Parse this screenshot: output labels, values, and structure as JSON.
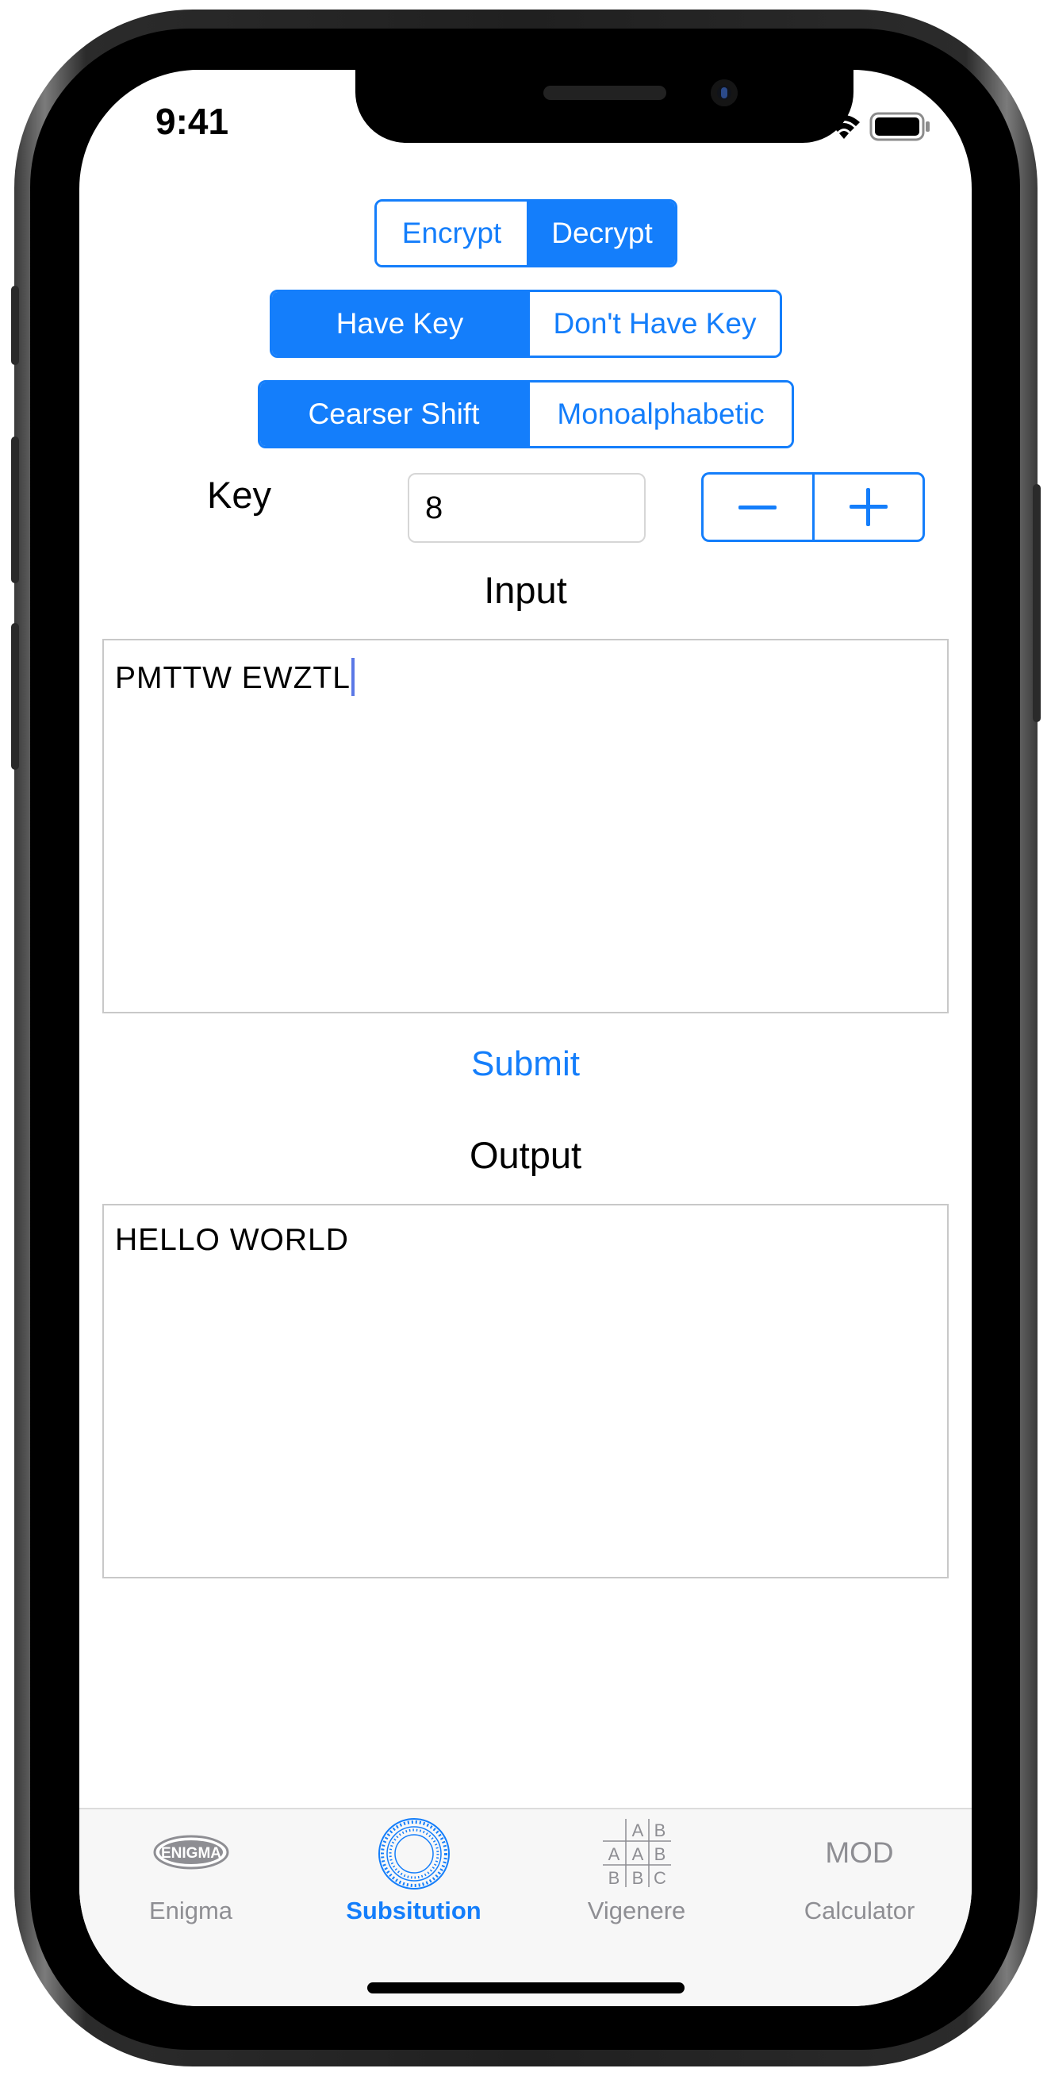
{
  "status_bar": {
    "time": "9:41"
  },
  "mode_segment": {
    "items": [
      "Encrypt",
      "Decrypt"
    ],
    "selected": "Decrypt"
  },
  "key_segment": {
    "items": [
      "Have Key",
      "Don't Have Key"
    ],
    "selected": "Have Key"
  },
  "cipher_segment": {
    "items": [
      "Cearser Shift",
      "Monoalphabetic"
    ],
    "selected": "Cearser Shift"
  },
  "key": {
    "label": "Key",
    "value": "8"
  },
  "input": {
    "label": "Input",
    "value": "PMTTW EWZTL"
  },
  "submit_label": "Submit",
  "output": {
    "label": "Output",
    "value": "HELLO WORLD"
  },
  "tabbar": {
    "tabs": [
      {
        "label": "Enigma",
        "icon": "enigma-logo-icon",
        "logo_text": "ENIGMA"
      },
      {
        "label": "Subsitution",
        "icon": "cipher-wheel-icon"
      },
      {
        "label": "Vigenere",
        "icon": "vigenere-table-icon",
        "grid": [
          "A",
          "B",
          "A",
          "A",
          "B",
          "B",
          "B",
          "C"
        ]
      },
      {
        "label": "Calculator",
        "icon": "mod-icon",
        "icon_text": "MOD"
      }
    ],
    "selected": "Subsitution"
  },
  "colors": {
    "accent": "#147EFB",
    "inactive": "#8e8e93",
    "caret": "#5b78e6"
  }
}
